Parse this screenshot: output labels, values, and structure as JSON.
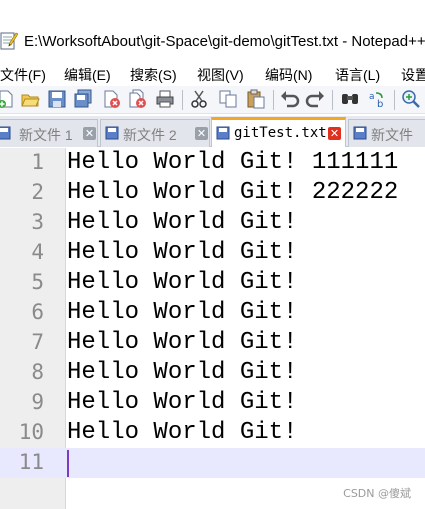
{
  "window": {
    "title": "E:\\WorksoftAbout\\git-Space\\git-demo\\gitTest.txt - Notepad++"
  },
  "menu": {
    "items": [
      "文件(F)",
      "编辑(E)",
      "搜索(S)",
      "视图(V)",
      "编码(N)",
      "语言(L)",
      "设置"
    ]
  },
  "toolbar": {
    "icons": [
      "new-file-icon",
      "open-file-icon",
      "save-icon",
      "save-all-icon",
      "close-icon",
      "close-all-icon",
      "print-icon",
      "cut-icon",
      "copy-icon",
      "paste-icon",
      "undo-icon",
      "redo-icon",
      "find-icon",
      "replace-icon",
      "zoom-in-icon"
    ]
  },
  "tabs": [
    {
      "label": "新文件 1",
      "active": false
    },
    {
      "label": "新文件 2",
      "active": false
    },
    {
      "label": "gitTest.txt",
      "active": true
    },
    {
      "label": "新文件",
      "active": false
    }
  ],
  "editor": {
    "lines": [
      {
        "num": "1",
        "text": "Hello World Git! 111111"
      },
      {
        "num": "2",
        "text": "Hello World Git! 222222"
      },
      {
        "num": "3",
        "text": "Hello World Git!"
      },
      {
        "num": "4",
        "text": "Hello World Git!"
      },
      {
        "num": "5",
        "text": "Hello World Git!"
      },
      {
        "num": "6",
        "text": "Hello World Git!"
      },
      {
        "num": "7",
        "text": "Hello World Git!"
      },
      {
        "num": "8",
        "text": "Hello World Git!"
      },
      {
        "num": "9",
        "text": "Hello World Git!"
      },
      {
        "num": "10",
        "text": "Hello World Git!"
      },
      {
        "num": "11",
        "text": ""
      }
    ],
    "current_line": 11
  },
  "watermark": "CSDN @傻斌",
  "colors": {
    "active_tab_accent": "#f5a623",
    "tab_close_active": "#e0301e",
    "tab_close_inactive": "#9aa0aa",
    "current_line_bg": "#e8e8ff",
    "gutter_bg": "#eeeeee",
    "caret": "#7a3cc8"
  }
}
